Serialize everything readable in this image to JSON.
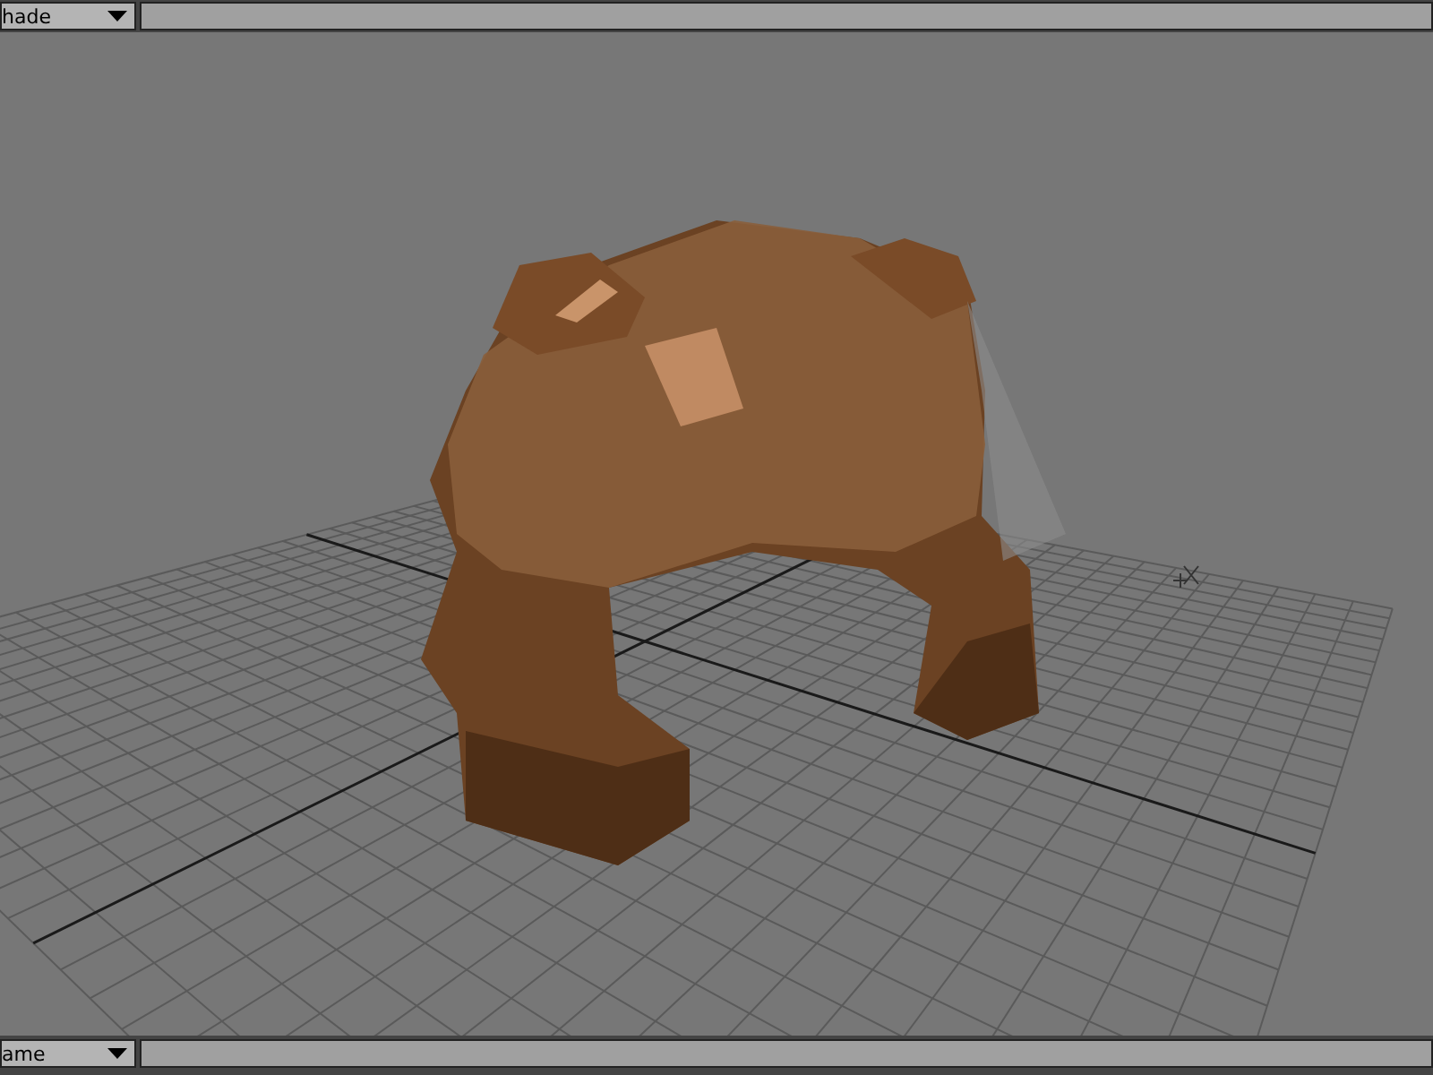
{
  "top_bar": {
    "dropdown": {
      "value": "hade"
    }
  },
  "bottom_bar": {
    "dropdown": {
      "value": "ame"
    }
  }
}
